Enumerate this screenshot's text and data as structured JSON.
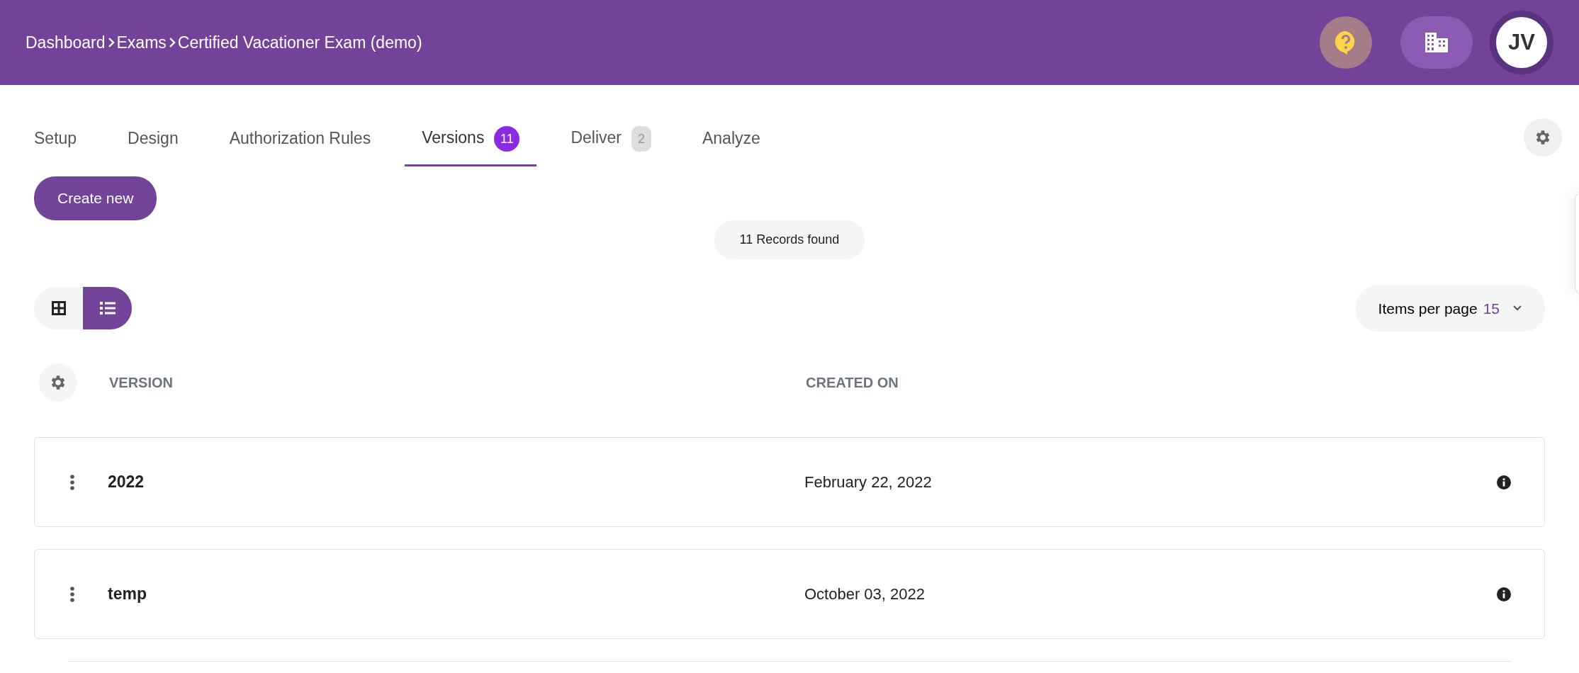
{
  "breadcrumb": [
    "Dashboard",
    "Exams",
    "Certified Vacationer Exam (demo)"
  ],
  "user": {
    "initials": "JV"
  },
  "tabs": [
    {
      "label": "Setup",
      "selected": false
    },
    {
      "label": "Design",
      "selected": false
    },
    {
      "label": "Authorization Rules",
      "selected": false
    },
    {
      "label": "Versions",
      "selected": true,
      "count": "11"
    },
    {
      "label": "Deliver",
      "selected": false,
      "count": "2"
    },
    {
      "label": "Analyze",
      "selected": false
    }
  ],
  "create_button": "Create new",
  "records": {
    "count": "11",
    "label": "Records found"
  },
  "view_modes": [
    {
      "kind": "grid",
      "selected": false
    },
    {
      "kind": "list",
      "selected": true
    }
  ],
  "items_per_page": {
    "label": "Items per page",
    "value": "15"
  },
  "table": {
    "columns": [
      "VERSION",
      "CREATED ON"
    ],
    "rows": [
      {
        "version": "2022",
        "created_on": "February 22, 2022"
      },
      {
        "version": "temp",
        "created_on": "October 03, 2022"
      }
    ]
  }
}
